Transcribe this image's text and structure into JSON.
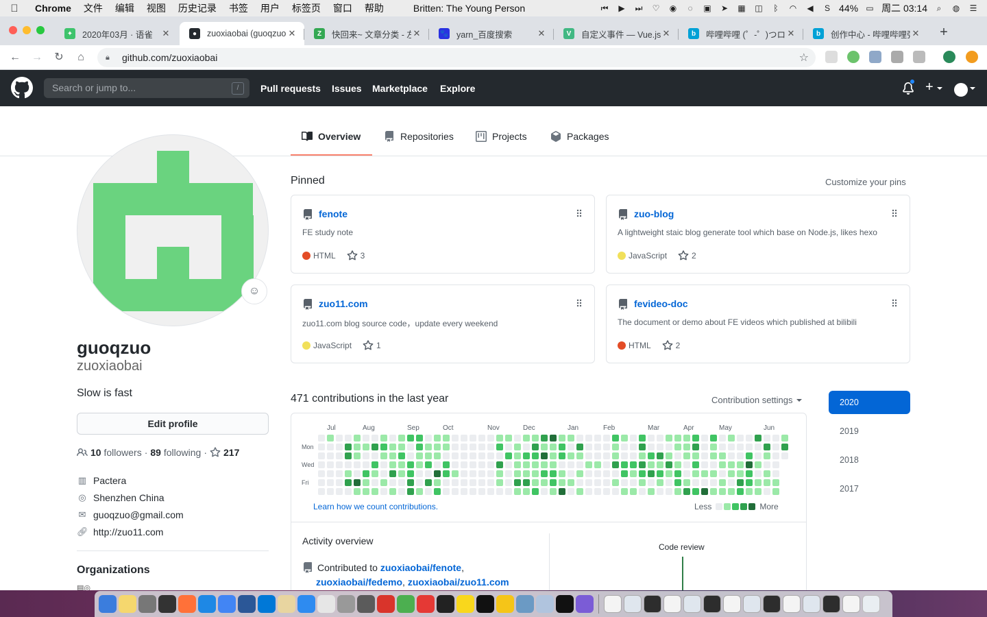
{
  "menubar": {
    "app_name": "Chrome",
    "menus": [
      "文件",
      "编辑",
      "视图",
      "历史记录",
      "书签",
      "用户",
      "标签页",
      "窗口",
      "帮助"
    ],
    "now_playing": "Britten: The Young Person",
    "battery": "44%",
    "clock": "周二 03:14"
  },
  "tabs": [
    {
      "title": "2020年03月 · 语雀",
      "fav_color": "#3ec36c",
      "fav_glyph": "✦"
    },
    {
      "title": "zuoxiaobai (guoqzuo",
      "fav_color": "#24292e",
      "fav_glyph": "●"
    },
    {
      "title": "快回来~ 文章分类 - 左",
      "fav_color": "#34a853",
      "fav_glyph": "Z"
    },
    {
      "title": "yarn_百度搜索",
      "fav_color": "#2932e1",
      "fav_glyph": "🐾"
    },
    {
      "title": "自定义事件 — Vue.js",
      "fav_color": "#41b883",
      "fav_glyph": "V"
    },
    {
      "title": "哔哩哔哩 (゜-゜)つロ",
      "fav_color": "#00a1d6",
      "fav_glyph": "b"
    },
    {
      "title": "创作中心 - 哔哩哔哩弹",
      "fav_color": "#00a1d6",
      "fav_glyph": "b"
    }
  ],
  "tab_close_glyph": "✕",
  "new_tab_glyph": "+",
  "address_bar": {
    "url": "github.com/zuoxiaobai"
  },
  "github_header": {
    "search_placeholder": "Search or jump to...",
    "search_shortcut": "/",
    "nav": [
      "Pull requests",
      "Issues",
      "Marketplace",
      "Explore"
    ]
  },
  "profile_tabs": [
    "Overview",
    "Repositories",
    "Projects",
    "Packages"
  ],
  "profile": {
    "full_name": "guoqzuo",
    "username": "zuoxiaobai",
    "bio": "Slow is fast",
    "edit_profile_label": "Edit profile",
    "followers_count": "10",
    "followers_label": "followers",
    "following_count": "89",
    "following_label": "following",
    "stars_count": "217",
    "separator": "·",
    "company": "Pactera",
    "location": "Shenzhen China",
    "email": "guoqzuo@gmail.com",
    "website": "http://zuo11.com",
    "organizations_title": "Organizations"
  },
  "pinned": {
    "title": "Pinned",
    "customize_label": "Customize your pins",
    "repos": [
      {
        "name": "fenote",
        "description": "FE study note",
        "language": "HTML",
        "language_color": "#e34c26",
        "stars": "3"
      },
      {
        "name": "zuo-blog",
        "description": "A lightweight staic blog generate tool which base on Node.js, likes hexo",
        "language": "JavaScript",
        "language_color": "#f1e05a",
        "stars": "2"
      },
      {
        "name": "zuo11.com",
        "description": "zuo11.com blog source code，update every weekend",
        "language": "JavaScript",
        "language_color": "#f1e05a",
        "stars": "1"
      },
      {
        "name": "fevideo-doc",
        "description": "The document or demo about FE videos which published at bilibili",
        "language": "HTML",
        "language_color": "#e34c26",
        "stars": "2"
      }
    ]
  },
  "contributions": {
    "title": "471 contributions in the last year",
    "settings_label": "Contribution settings",
    "months": [
      "Jul",
      "Aug",
      "Sep",
      "Oct",
      "Nov",
      "Dec",
      "Jan",
      "Feb",
      "Mar",
      "Apr",
      "May",
      "Jun"
    ],
    "day_labels": [
      "Mon",
      "Wed",
      "Fri"
    ],
    "learn_link": "Learn how we count contributions.",
    "legend_less": "Less",
    "legend_more": "More",
    "level_colors": [
      "#ebedf0",
      "#9be9a8",
      "#40c463",
      "#30a14e",
      "#216e39"
    ],
    "weeks": 53
  },
  "activity": {
    "title": "Activity overview",
    "contributed_to": "Contributed to",
    "repo_1": "zuoxiaobai/fenote",
    "repo_2": "zuoxiaobai/fedemo",
    "repo_3": "zuoxiaobai/zuo11.com",
    "code_review_label": "Code review"
  },
  "years": [
    "2020",
    "2019",
    "2018",
    "2017"
  ],
  "colors": {
    "gh_dark": "#24292e",
    "link_blue": "#0366d6",
    "tab_underline": "#f9826c",
    "avatar_green": "#6ad37f"
  }
}
